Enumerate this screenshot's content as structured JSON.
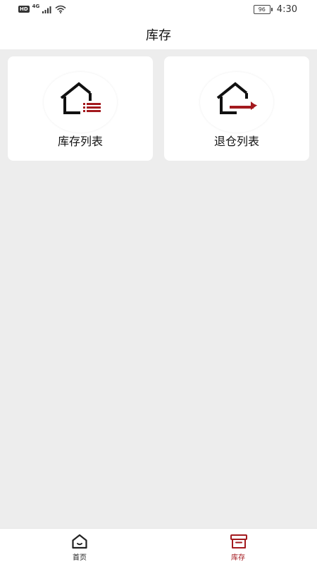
{
  "status_bar": {
    "hd_label": "HD",
    "network_label": "4G",
    "battery_level": "96",
    "time": "4:30"
  },
  "header": {
    "title": "库存"
  },
  "cards": [
    {
      "label": "库存列表",
      "icon": "house-list-icon"
    },
    {
      "label": "退仓列表",
      "icon": "house-return-icon"
    }
  ],
  "tab_bar": {
    "items": [
      {
        "label": "首页",
        "icon": "home-icon",
        "active": false
      },
      {
        "label": "库存",
        "icon": "archive-box-icon",
        "active": true
      }
    ]
  },
  "colors": {
    "accent": "#a3191e",
    "background": "#ededed",
    "surface": "#ffffff",
    "text": "#111111"
  }
}
